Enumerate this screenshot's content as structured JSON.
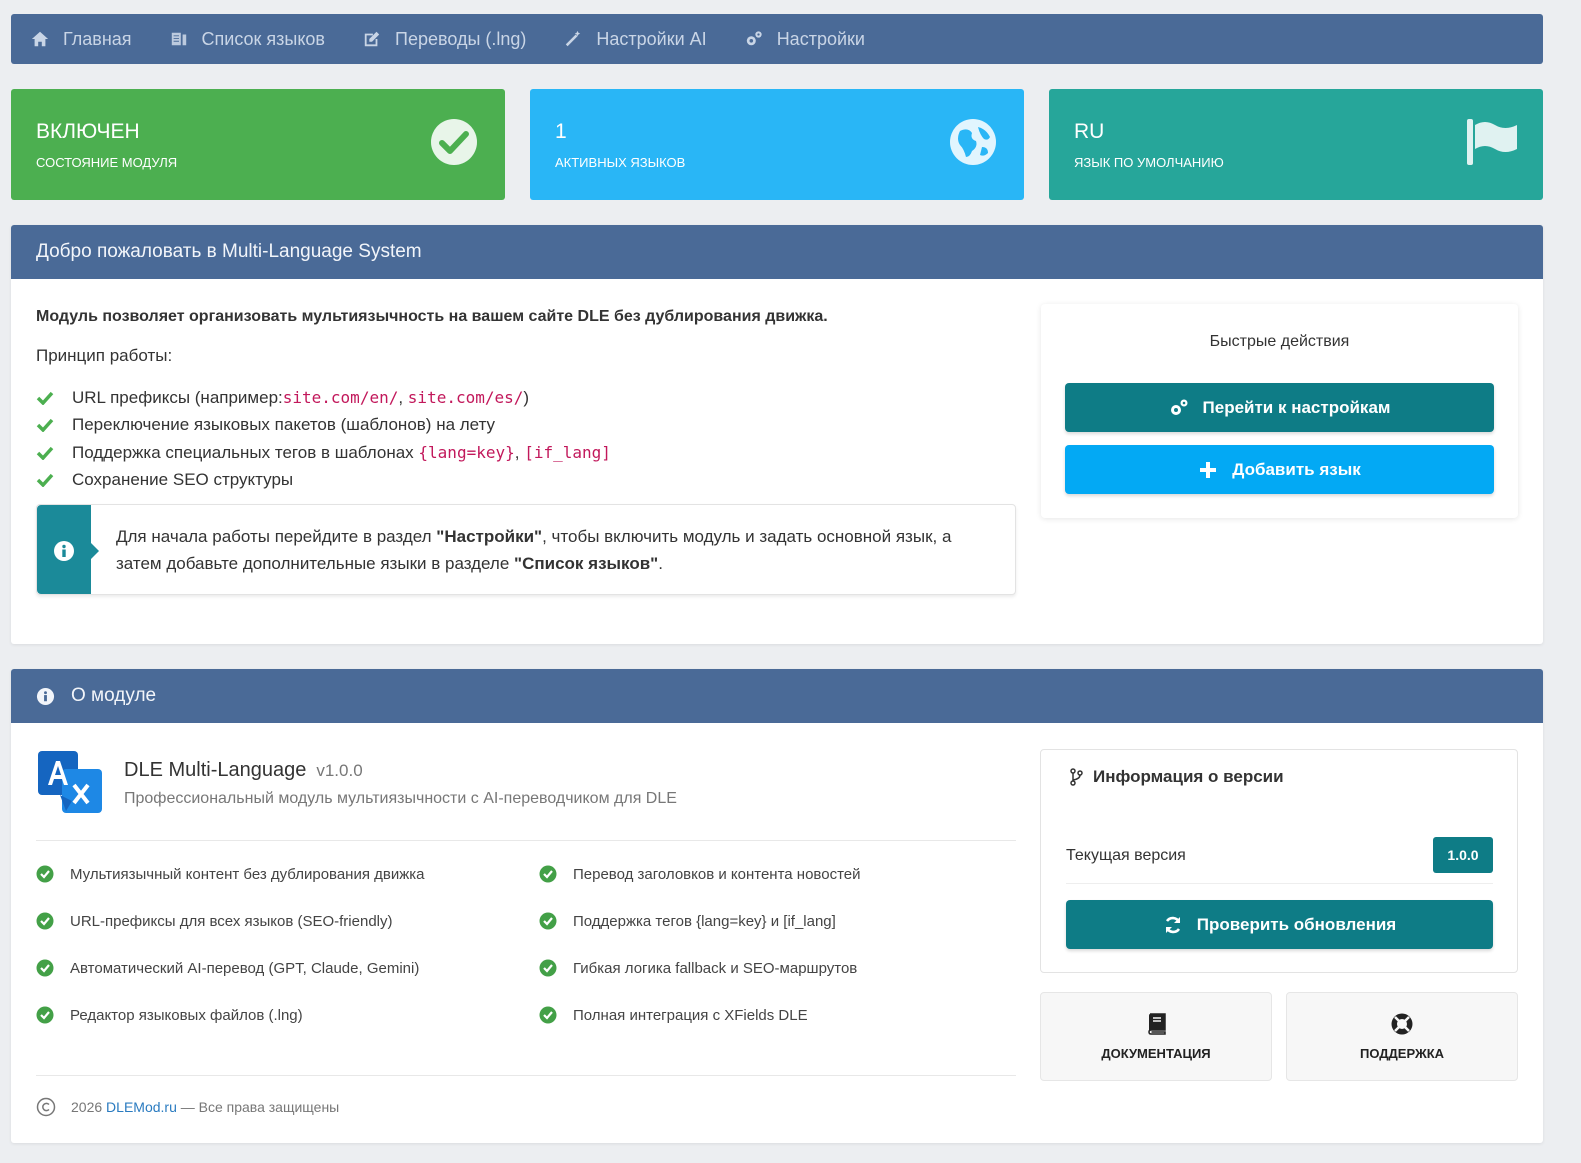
{
  "nav": {
    "items": [
      {
        "label": "Главная",
        "icon": "home-icon"
      },
      {
        "label": "Список языков",
        "icon": "language-list-icon"
      },
      {
        "label": "Переводы (.lng)",
        "icon": "edit-icon"
      },
      {
        "label": "Настройки AI",
        "icon": "magic-wand-icon"
      },
      {
        "label": "Настройки",
        "icon": "gears-icon"
      }
    ]
  },
  "stats": {
    "module": {
      "value": "ВКЛЮЧЕН",
      "label": "СОСТОЯНИЕ МОДУЛЯ",
      "color": "#4caf50"
    },
    "languages": {
      "value": "1",
      "label": "АКТИВНЫХ ЯЗЫКОВ",
      "color": "#29b6f6"
    },
    "default": {
      "value": "RU",
      "label": "ЯЗЫК ПО УМОЛЧАНИЮ",
      "color": "#26a69a"
    }
  },
  "welcome": {
    "title": "Добро пожаловать в Multi-Language System",
    "intro": "Модуль позволяет организовать мультиязычность на вашем сайте DLE без дублирования движка.",
    "principle": "Принцип работы:",
    "f1_text": "URL префиксы (например: ",
    "f1_code1": "site.com/en/",
    "f1_sep": ", ",
    "f1_code2": "site.com/es/",
    "f1_end": ")",
    "f2": "Переключение языковых пакетов (шаблонов) на лету",
    "f3_text": "Поддержка специальных тегов в шаблонах ",
    "f3_code1": "{lang=key}",
    "f3_sep": ", ",
    "f3_code2": "[if_lang]",
    "f4": "Сохранение SEO структуры",
    "callout_a": "Для начала работы перейдите в раздел ",
    "callout_b": "\"Настройки\"",
    "callout_c": ", чтобы включить модуль и задать основной язык, а затем добавьте дополнительные языки в разделе ",
    "callout_d": "\"Список языков\"",
    "callout_e": "."
  },
  "quick": {
    "title": "Быстрые действия",
    "settings_btn": "Перейти к настройкам",
    "add_btn": "Добавить язык"
  },
  "about": {
    "title": "О модуле",
    "name": "DLE Multi-Language",
    "version": "v1.0.0",
    "desc": "Профессиональный модуль мультиязычности с AI-переводчиком для DLE",
    "features_left": [
      "Мультиязычный контент без дублирования движка",
      "URL-префиксы для всех языков (SEO-friendly)",
      "Автоматический AI-перевод (GPT, Claude, Gemini)",
      "Редактор языковых файлов (.lng)"
    ],
    "features_right": [
      "Перевод заголовков и контента новостей",
      "Поддержка тегов {lang=key} и [if_lang]",
      "Гибкая логика fallback и SEO-маршрутов",
      "Полная интеграция с XFields DLE"
    ],
    "copy_year": "2026",
    "copy_link": "DLEMod.ru",
    "copy_rest": "— Все права защищены"
  },
  "version_info": {
    "title": "Информация о версии",
    "current_label": "Текущая версия",
    "current_value": "1.0.0",
    "check_btn": "Проверить обновления"
  },
  "cards": {
    "docs": "ДОКУМЕНТАЦИЯ",
    "support": "ПОДДЕРЖКА"
  },
  "colors": {
    "nav": "#4a6a97",
    "teal_button": "#0e7c86",
    "blue_button": "#03a9f4",
    "check_green": "#4caf50",
    "code_pink": "#c2185b"
  }
}
